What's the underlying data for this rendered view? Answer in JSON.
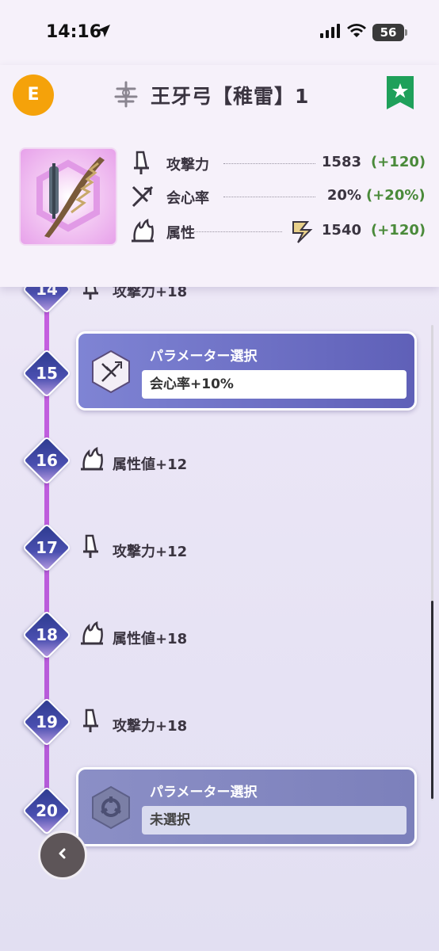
{
  "status": {
    "time": "14:16",
    "battery": "56"
  },
  "header": {
    "rank": "E",
    "weapon_name": "王牙弓【稚雷】1",
    "favorite": true
  },
  "stats": [
    {
      "label": "攻撃力",
      "value": "1583",
      "bonus": "(+120)",
      "icon": "attack-icon"
    },
    {
      "label": "会心率",
      "value": "20%",
      "bonus": "(+20%)",
      "icon": "critical-icon"
    },
    {
      "label": "属性",
      "value": "1540",
      "bonus": "(+120)",
      "icon": "element-icon",
      "element": "thunder-icon"
    }
  ],
  "levels": {
    "l14": {
      "num": "14",
      "text": "攻撃力+18"
    },
    "l15": {
      "num": "15",
      "card_title": "パラメーター選択",
      "value": "会心率+10%"
    },
    "l16": {
      "num": "16",
      "text": "属性値+12"
    },
    "l17": {
      "num": "17",
      "text": "攻撃力+12"
    },
    "l18": {
      "num": "18",
      "text": "属性値+18"
    },
    "l19": {
      "num": "19",
      "text": "攻撃力+18"
    },
    "l20": {
      "num": "20",
      "card_title": "パラメーター選択",
      "value": "未選択"
    }
  },
  "colors": {
    "rank_badge": "#f5a20a",
    "bonus_green": "#4a8a3a",
    "timeline": "#c65fe0",
    "card_active": "#5f60b8",
    "ribbon": "#1fa05a"
  }
}
